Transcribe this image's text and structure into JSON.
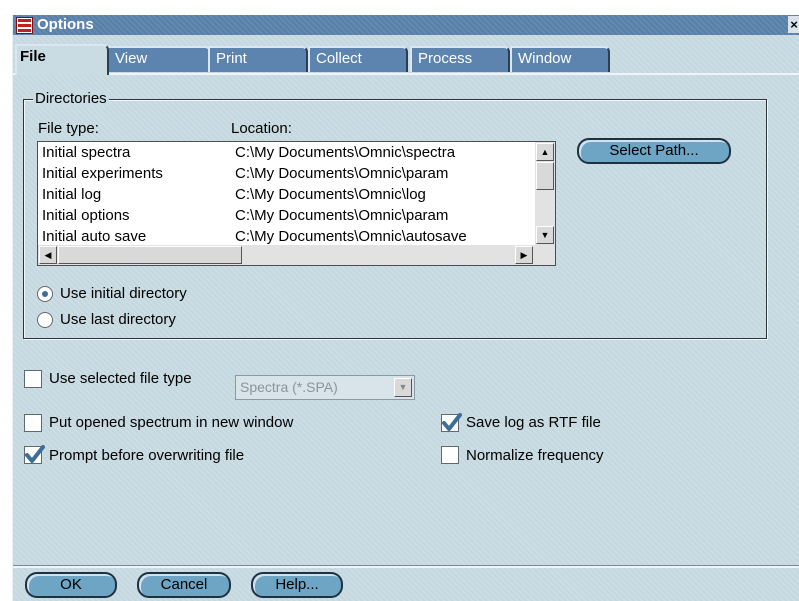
{
  "window": {
    "title": "Options",
    "close_glyph": "×"
  },
  "tabs": [
    {
      "label": "File",
      "active": true
    },
    {
      "label": "View"
    },
    {
      "label": "Print"
    },
    {
      "label": "Collect"
    },
    {
      "label": "Process"
    },
    {
      "label": "Window"
    }
  ],
  "directories": {
    "group_label": "Directories",
    "col_file_type": "File type:",
    "col_location": "Location:",
    "rows": [
      {
        "type": "Initial spectra",
        "location": "C:\\My Documents\\Omnic\\spectra"
      },
      {
        "type": "Initial experiments",
        "location": "C:\\My Documents\\Omnic\\param"
      },
      {
        "type": "Initial log",
        "location": "C:\\My Documents\\Omnic\\log"
      },
      {
        "type": "Initial options",
        "location": "C:\\My Documents\\Omnic\\param"
      },
      {
        "type": "Initial auto save",
        "location": "C:\\My Documents\\Omnic\\autosave"
      }
    ],
    "select_path_label": "Select Path...",
    "radio_initial": "Use initial directory",
    "radio_last": "Use last directory",
    "selected_radio": "initial"
  },
  "options": {
    "use_selected_file_type": {
      "label": "Use selected file type",
      "checked": false
    },
    "file_type_select": {
      "value": "Spectra (*.SPA)",
      "disabled": true
    },
    "put_opened_spectrum": {
      "label": "Put opened spectrum in new window",
      "checked": false
    },
    "prompt_before_overwriting": {
      "label": "Prompt before overwriting file",
      "checked": true
    },
    "save_log_rtf": {
      "label": "Save log as RTF file",
      "checked": true
    },
    "normalize_frequency": {
      "label": "Normalize frequency",
      "checked": false
    }
  },
  "footer": {
    "ok_label": "OK",
    "cancel_label": "Cancel",
    "help_label": "Help..."
  },
  "colors": {
    "titlebar": "#5c84ae",
    "dialog_bg": "#c9dbe3",
    "button": "#6ea4c4",
    "check_accent": "#3c6e98"
  }
}
